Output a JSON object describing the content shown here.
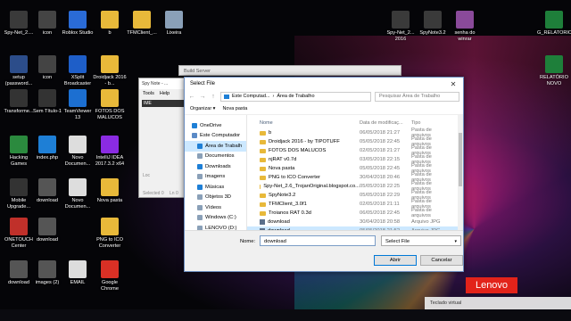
{
  "desktop_icons": [
    {
      "label": "Spy-Net_2....",
      "color": "#3a3a3a"
    },
    {
      "label": "icon",
      "color": "#444"
    },
    {
      "label": "Roblox Studio",
      "color": "#2a6bd6"
    },
    {
      "label": "b",
      "color": "#e8b93a"
    },
    {
      "label": "TFMClient_...",
      "color": "#e8b93a"
    },
    {
      "label": "Lixeira",
      "color": "#8aa0b8"
    },
    {
      "label": "setup (password...",
      "color": "#2c4d8a"
    },
    {
      "label": "icon",
      "color": "#444"
    },
    {
      "label": "XSplit Broadcaster",
      "color": "#1e5ec8"
    },
    {
      "label": "Droidjack 2016 - b...",
      "color": "#e8b93a"
    },
    {
      "label": "Transforme...",
      "color": "#333"
    },
    {
      "label": "Sem Título-1",
      "color": "#333"
    },
    {
      "label": "TeamViewer 13",
      "color": "#1c6fd1"
    },
    {
      "label": "FOTOS DOS MALUCOS",
      "color": "#e8b93a"
    },
    {
      "label": "Hacking Games",
      "color": "#2b8a3e"
    },
    {
      "label": "index.php",
      "color": "#1e7fd6"
    },
    {
      "label": "Novo Documen...",
      "color": "#ddd"
    },
    {
      "label": "IntelliJ IDEA 2017.3.2 x64",
      "color": "#8a2be2"
    },
    {
      "label": "Mobile Upgrade...",
      "color": "#333"
    },
    {
      "label": "download",
      "color": "#555"
    },
    {
      "label": "Novo Documen...",
      "color": "#ddd"
    },
    {
      "label": "Nova pasta",
      "color": "#e8b93a"
    },
    {
      "label": "ONETOUCH Center",
      "color": "#c0302a"
    },
    {
      "label": "download",
      "color": "#555"
    },
    {
      "label": "PNG to ICO Converter",
      "color": "#e8b93a"
    },
    {
      "label": "download",
      "color": "#555"
    },
    {
      "label": "images (2)",
      "color": "#555"
    },
    {
      "label": "EMAIL",
      "color": "#ddd"
    },
    {
      "label": "Google Chrome",
      "color": "#d93025"
    },
    {
      "label": "Spy-Net_2... 2016",
      "color": "#3a3a3a"
    },
    {
      "label": "SpyNote3.2",
      "color": "#3a3a3a"
    },
    {
      "label": "senha do winrar",
      "color": "#8a4a9a"
    },
    {
      "label": "G_RELATORIO",
      "color": "#1e7f3a"
    },
    {
      "label": "RELATÓRIO NOVO",
      "color": "#1e7f3a"
    }
  ],
  "back_window": {
    "title": "Spy Note - ...",
    "menu": [
      "Tools",
      "Help"
    ],
    "status": "Selected 0",
    "label1": "IME",
    "label2": "Loc",
    "label3": "Ln 0"
  },
  "build_server_title": "Build Server",
  "dialog": {
    "title": "Select File",
    "close": "✕",
    "path": [
      "Este Computad...",
      "Área de Trabalho"
    ],
    "search_placeholder": "Pesquisar Área de Trabalho",
    "toolbar": {
      "organize": "Organizar ▾",
      "new_folder": "Nova pasta"
    },
    "nav_items": [
      {
        "label": "OneDrive",
        "color": "#1e7fd6"
      },
      {
        "label": "Este Computador",
        "color": "#5a8ac6"
      },
      {
        "label": "Área de Trabalh",
        "color": "#1e7fd6"
      },
      {
        "label": "Documentos",
        "color": "#8aa0b8"
      },
      {
        "label": "Downloads",
        "color": "#1e7fd6"
      },
      {
        "label": "Imagens",
        "color": "#8aa0b8"
      },
      {
        "label": "Músicas",
        "color": "#1e7fd6"
      },
      {
        "label": "Objetos 3D",
        "color": "#8aa0b8"
      },
      {
        "label": "Vídeos",
        "color": "#8aa0b8"
      },
      {
        "label": "Windows (C:)",
        "color": "#8aa0b8"
      },
      {
        "label": "LENOVO (D:)",
        "color": "#8aa0b8"
      },
      {
        "label": "Rede",
        "color": "#8aa0b8"
      }
    ],
    "columns": [
      "Nome",
      "Data de modificaç...",
      "Tipo"
    ],
    "files": [
      {
        "name": "b",
        "date": "06/05/2018 21:27",
        "type": "Pasta de arquivos",
        "kind": "folder"
      },
      {
        "name": "Droidjack 2016 - by TIPOTUFF",
        "date": "05/05/2018 22:45",
        "type": "Pasta de arquivos",
        "kind": "folder"
      },
      {
        "name": "FOTOS DOS MALUCOS",
        "date": "02/05/2018 21:27",
        "type": "Pasta de arquivos",
        "kind": "folder"
      },
      {
        "name": "njRAT v0.7d",
        "date": "03/05/2018 22:15",
        "type": "Pasta de arquivos",
        "kind": "folder"
      },
      {
        "name": "Nova pasta",
        "date": "05/05/2018 22:45",
        "type": "Pasta de arquivos",
        "kind": "folder"
      },
      {
        "name": "PNG to ICO Converter",
        "date": "30/04/2018 20:46",
        "type": "Pasta de arquivos",
        "kind": "folder"
      },
      {
        "name": "Spy-Net_2.6_TrojanOriginal.blogspot.co...",
        "date": "05/05/2018 22:25",
        "type": "Pasta de arquivos",
        "kind": "folder"
      },
      {
        "name": "SpyNote3.2",
        "date": "05/05/2018 22:29",
        "type": "Pasta de arquivos",
        "kind": "folder"
      },
      {
        "name": "TFMClient_3.0f1",
        "date": "02/05/2018 21:11",
        "type": "Pasta de arquivos",
        "kind": "folder"
      },
      {
        "name": "Troianos RAT 0.3d",
        "date": "06/05/2018 22:45",
        "type": "Pasta de arquivos",
        "kind": "folder"
      },
      {
        "name": "download",
        "date": "30/04/2018 20:58",
        "type": "Arquivo JPG",
        "kind": "file"
      },
      {
        "name": "download",
        "date": "05/05/2018 21:52",
        "type": "Arquivo JPG",
        "kind": "file",
        "selected": true
      }
    ],
    "name_label": "Nome:",
    "name_value": "download",
    "filter_value": "Select File",
    "open_button": "Abrir",
    "cancel_button": "Cancelar"
  },
  "lenovo": "Lenovo",
  "virtual_keyboard": "Teclado virtual"
}
